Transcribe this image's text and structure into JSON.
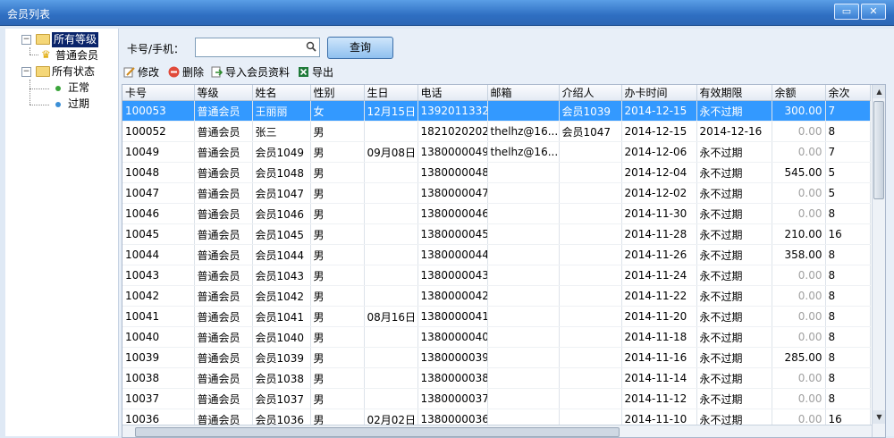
{
  "window": {
    "title": "会员列表",
    "min_glyph": "▭",
    "close_glyph": "✕"
  },
  "tree": {
    "levels_root": "所有等级",
    "level_items": [
      "普通会员"
    ],
    "status_root": "所有状态",
    "status_items": [
      "正常",
      "过期"
    ],
    "colors": {
      "normal_dot": "#3aa53a",
      "expired_dot": "#3b8fd6",
      "selected_bg": "#0a246a"
    }
  },
  "search": {
    "label": "卡号/手机：",
    "value": "",
    "button": "查询"
  },
  "toolbar": {
    "edit": "修改",
    "delete": "删除",
    "import": "导入会员资料",
    "export": "导出"
  },
  "table": {
    "headers": [
      "卡号",
      "等级",
      "姓名",
      "性别",
      "生日",
      "电话",
      "邮箱",
      "介绍人",
      "办卡时间",
      "有效期限",
      "余额",
      "余次"
    ],
    "rows": [
      [
        "100053",
        "普通会员",
        "王丽丽",
        "女",
        "12月15日",
        "1392011332",
        "",
        "会员1039",
        "2014-12-15",
        "永不过期",
        "300.00",
        "7"
      ],
      [
        "100052",
        "普通会员",
        "张三",
        "男",
        "",
        "1821020202",
        "thelhz@16...",
        "会员1047",
        "2014-12-15",
        "2014-12-16",
        "0.00",
        "8"
      ],
      [
        "10049",
        "普通会员",
        "会员1049",
        "男",
        "09月08日",
        "1380000049",
        "thelhz@16...",
        "",
        "2014-12-06",
        "永不过期",
        "0.00",
        "7"
      ],
      [
        "10048",
        "普通会员",
        "会员1048",
        "男",
        "",
        "1380000048",
        "",
        "",
        "2014-12-04",
        "永不过期",
        "545.00",
        "5"
      ],
      [
        "10047",
        "普通会员",
        "会员1047",
        "男",
        "",
        "1380000047",
        "",
        "",
        "2014-12-02",
        "永不过期",
        "0.00",
        "5"
      ],
      [
        "10046",
        "普通会员",
        "会员1046",
        "男",
        "",
        "1380000046",
        "",
        "",
        "2014-11-30",
        "永不过期",
        "0.00",
        "8"
      ],
      [
        "10045",
        "普通会员",
        "会员1045",
        "男",
        "",
        "1380000045",
        "",
        "",
        "2014-11-28",
        "永不过期",
        "210.00",
        "16"
      ],
      [
        "10044",
        "普通会员",
        "会员1044",
        "男",
        "",
        "1380000044",
        "",
        "",
        "2014-11-26",
        "永不过期",
        "358.00",
        "8"
      ],
      [
        "10043",
        "普通会员",
        "会员1043",
        "男",
        "",
        "1380000043",
        "",
        "",
        "2014-11-24",
        "永不过期",
        "0.00",
        "8"
      ],
      [
        "10042",
        "普通会员",
        "会员1042",
        "男",
        "",
        "1380000042",
        "",
        "",
        "2014-11-22",
        "永不过期",
        "0.00",
        "8"
      ],
      [
        "10041",
        "普通会员",
        "会员1041",
        "男",
        "08月16日",
        "1380000041",
        "",
        "",
        "2014-11-20",
        "永不过期",
        "0.00",
        "8"
      ],
      [
        "10040",
        "普通会员",
        "会员1040",
        "男",
        "",
        "1380000040",
        "",
        "",
        "2014-11-18",
        "永不过期",
        "0.00",
        "8"
      ],
      [
        "10039",
        "普通会员",
        "会员1039",
        "男",
        "",
        "1380000039",
        "",
        "",
        "2014-11-16",
        "永不过期",
        "285.00",
        "8"
      ],
      [
        "10038",
        "普通会员",
        "会员1038",
        "男",
        "",
        "1380000038",
        "",
        "",
        "2014-11-14",
        "永不过期",
        "0.00",
        "8"
      ],
      [
        "10037",
        "普通会员",
        "会员1037",
        "男",
        "",
        "1380000037",
        "",
        "",
        "2014-11-12",
        "永不过期",
        "0.00",
        "8"
      ],
      [
        "10036",
        "普通会员",
        "会员1036",
        "男",
        "02月02日",
        "1380000036",
        "",
        "",
        "2014-11-10",
        "永不过期",
        "0.00",
        "16"
      ]
    ],
    "selected_row": 0
  },
  "colors": {
    "selection": "#3399ff",
    "title_bar": "#2f6fc2",
    "zero_text": "#a0a0a0"
  }
}
